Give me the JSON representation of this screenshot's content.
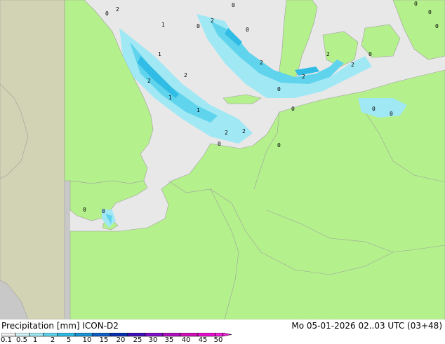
{
  "title": {
    "left": "Precipitation [mm] ICON-D2",
    "right": "Mo 05-01-2026 02..03 UTC (03+48)"
  },
  "legend": {
    "labels": [
      "0.1",
      "0.5",
      "1",
      "2",
      "5",
      "10",
      "15",
      "20",
      "25",
      "30",
      "35",
      "40",
      "45",
      "50"
    ],
    "colors": [
      "#f2f2f2",
      "#d0f4f8",
      "#a0e8f4",
      "#60d4ec",
      "#30bce4",
      "#1c94d8",
      "#1060c8",
      "#0a30b0",
      "#4010b8",
      "#8010c8",
      "#b010c0",
      "#d010b8",
      "#e810d0",
      "#f020d8"
    ]
  },
  "map_colors": {
    "sea": "#e8e8e8",
    "land": "#b4f08c",
    "outside_domain": "#c8c8c8",
    "outside_land": "#d2d2b4",
    "border": "#a0a0a0"
  },
  "precip_labels": [
    "1",
    "2",
    "0"
  ]
}
